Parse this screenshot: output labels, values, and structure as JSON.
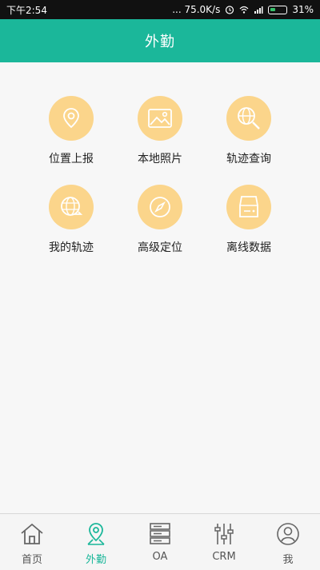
{
  "status_bar": {
    "time": "下午2:54",
    "speed": "... 75.0K/s",
    "battery": "31%"
  },
  "header": {
    "title": "外勤"
  },
  "grid": {
    "items": [
      {
        "label": "位置上报",
        "icon": "location-pin-icon"
      },
      {
        "label": "本地照片",
        "icon": "image-icon"
      },
      {
        "label": "轨迹查询",
        "icon": "globe-search-icon"
      },
      {
        "label": "我的轨迹",
        "icon": "globe-track-icon"
      },
      {
        "label": "高级定位",
        "icon": "compass-icon"
      },
      {
        "label": "离线数据",
        "icon": "storage-icon"
      }
    ]
  },
  "bottom_nav": {
    "items": [
      {
        "label": "首页",
        "icon": "home-icon",
        "active": false
      },
      {
        "label": "外勤",
        "icon": "map-pin-icon",
        "active": true
      },
      {
        "label": "OA",
        "icon": "server-icon",
        "active": false
      },
      {
        "label": "CRM",
        "icon": "sliders-icon",
        "active": false
      },
      {
        "label": "我",
        "icon": "user-icon",
        "active": false
      }
    ]
  },
  "colors": {
    "header_bg": "#1bb79a",
    "icon_circle": "#fbd58b",
    "active_nav": "#1bb79a"
  }
}
